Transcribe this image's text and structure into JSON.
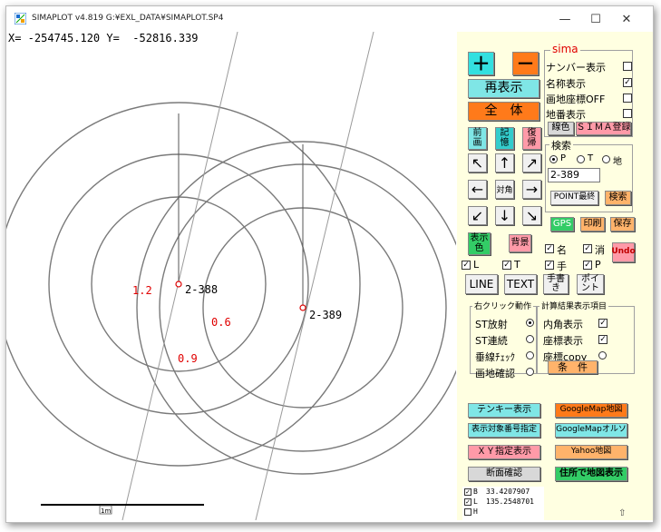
{
  "window": {
    "title": "SIMAPLOT v4.819  G:¥EXL_DATA¥SIMAPLOT.SP4",
    "minimize": "—",
    "maximize": "☐",
    "close": "✕"
  },
  "canvas": {
    "coords": "X= -254745.120 Y=  -52816.339",
    "points": [
      {
        "label": "2-388"
      },
      {
        "label": "2-389"
      }
    ],
    "distances": [
      "1.2",
      "0.6",
      "0.9"
    ],
    "scale_label": "1m"
  },
  "panel": {
    "zoom_in": "＋",
    "zoom_out": "－",
    "redraw": "再表示",
    "fit_all": "全　体",
    "sima": {
      "title": "sima",
      "items": [
        {
          "label": "ナンバー表示",
          "checked": false
        },
        {
          "label": "名称表示",
          "checked": true
        },
        {
          "label": "画地座標OFF",
          "checked": false
        },
        {
          "label": "地番表示",
          "checked": false
        }
      ],
      "line_color": "線色",
      "register": "ＳＩＭＡ登録"
    },
    "prev_screen": "前\n画",
    "memory": "記\n憶",
    "restore": "復\n帰",
    "diagonal": "対角",
    "arrows": [
      "↖",
      "↑",
      "↗",
      "←",
      "→",
      "↙",
      "↓",
      "↘"
    ],
    "search": {
      "title": "検索",
      "options": [
        "P",
        "T",
        "地"
      ],
      "selected": "P",
      "value": "2-389",
      "point_last": "POINT最終",
      "search_btn": "検索"
    },
    "gps": "GPS",
    "print": "印刷",
    "save": "保存",
    "display_color": "表示\n色",
    "background": "背景",
    "checks": [
      {
        "label": "名",
        "checked": true
      },
      {
        "label": "消",
        "checked": true
      },
      {
        "label": "L",
        "checked": true
      },
      {
        "label": "T",
        "checked": true
      },
      {
        "label": "手",
        "checked": true
      },
      {
        "label": "P",
        "checked": true
      }
    ],
    "undo": "Undo",
    "line_btn": "LINE",
    "text_btn": "TEXT",
    "handwrite": "手書\nき",
    "point_btn": "ポイ\nント",
    "rclick": {
      "title": "右クリック動作",
      "items": [
        {
          "label": "ST放射",
          "selected": true
        },
        {
          "label": "ST連続",
          "selected": false
        },
        {
          "label": "垂線ﾁｪｯｸ",
          "selected": false
        },
        {
          "label": "画地確認",
          "selected": false
        }
      ]
    },
    "calc": {
      "title": "計算結果表示項目",
      "items": [
        {
          "label": "内角表示",
          "type": "check",
          "checked": true
        },
        {
          "label": "座標表示",
          "type": "check",
          "checked": true
        },
        {
          "label": "座標copy",
          "type": "radio",
          "checked": false
        }
      ],
      "condition": "条　件"
    },
    "tenkey": "テンキー表示",
    "googlemap": "GoogleMap地図",
    "target_num": "表示対象番号指定",
    "googlemap_ortho": "GoogleMapオルソ",
    "xy_spec": "ＸＹ指定表示",
    "yahoo": "Yahoo地図",
    "cross_section": "断面確認",
    "address_map": "住所で地図表示",
    "latlon": [
      {
        "key": "B",
        "value": "33.4207907",
        "checked": true
      },
      {
        "key": "L",
        "value": "135.2548701",
        "checked": true
      },
      {
        "key": "H",
        "value": "",
        "checked": false
      }
    ],
    "colors": {
      "plus_bg": "#33e0e0",
      "minus_bg": "#ff7a1a",
      "cyan_btn": "#7fe6e6",
      "orange_btn": "#ffb36b",
      "pink_btn": "#ff9aa8",
      "green_btn": "#33cc66",
      "grey_btn": "#d8d8d8",
      "accent_red": "#e00000"
    }
  }
}
